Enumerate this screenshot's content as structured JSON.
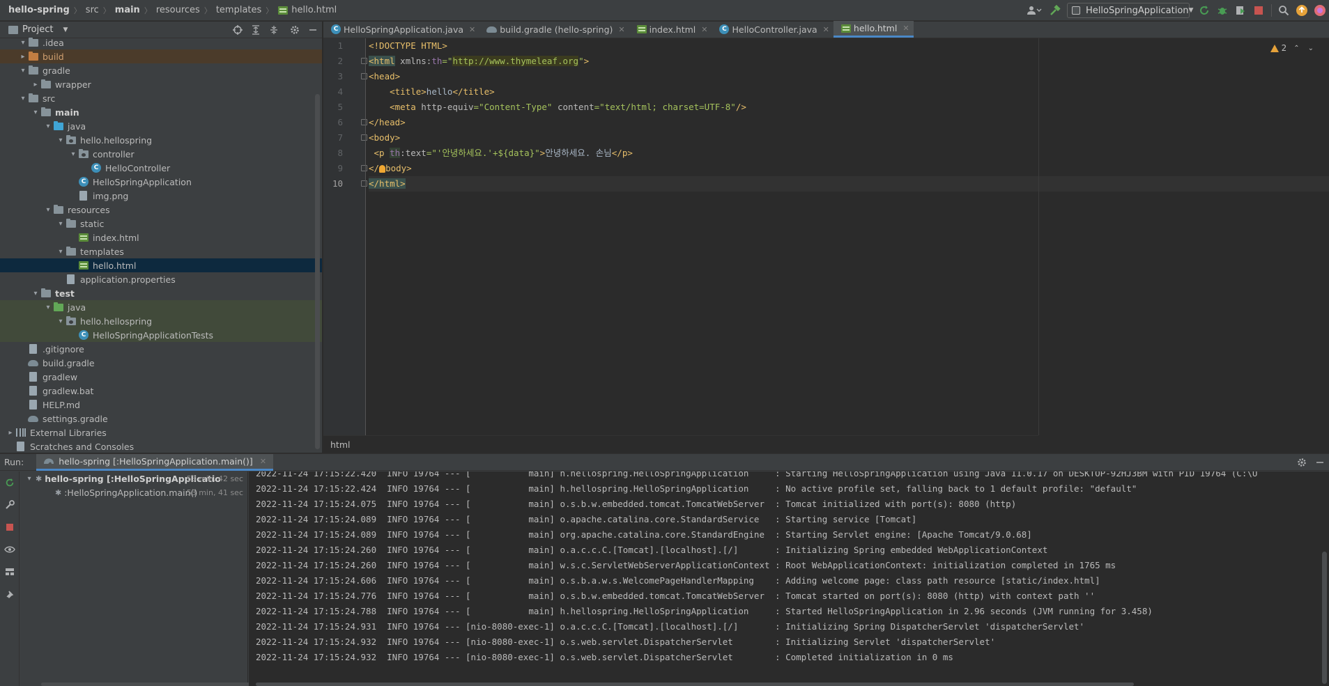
{
  "breadcrumb": [
    {
      "label": "hello-spring",
      "bold": true
    },
    {
      "label": "src",
      "bold": false
    },
    {
      "label": "main",
      "bold": true
    },
    {
      "label": "resources",
      "bold": false
    },
    {
      "label": "templates",
      "bold": false
    },
    {
      "label": "hello.html",
      "bold": false
    }
  ],
  "toolbar": {
    "run_config": "HelloSpringApplication"
  },
  "project": {
    "title": "Project",
    "tree": [
      {
        "label": ".idea",
        "level": 1,
        "arrow": "▾",
        "icon": "folder",
        "style": ""
      },
      {
        "label": "build",
        "level": 1,
        "arrow": "▸",
        "icon": "folder-orange",
        "style": "excluded"
      },
      {
        "label": "gradle",
        "level": 1,
        "arrow": "▾",
        "icon": "folder",
        "style": ""
      },
      {
        "label": "wrapper",
        "level": 2,
        "arrow": "▸",
        "icon": "folder",
        "style": ""
      },
      {
        "label": "src",
        "level": 1,
        "arrow": "▾",
        "icon": "folder",
        "style": ""
      },
      {
        "label": "main",
        "level": 2,
        "arrow": "▾",
        "icon": "folder",
        "style": "bold"
      },
      {
        "label": "java",
        "level": 3,
        "arrow": "▾",
        "icon": "folder-blue",
        "style": ""
      },
      {
        "label": "hello.hellospring",
        "level": 4,
        "arrow": "▾",
        "icon": "package",
        "style": ""
      },
      {
        "label": "controller",
        "level": 5,
        "arrow": "▾",
        "icon": "package",
        "style": ""
      },
      {
        "label": "HelloController",
        "level": 6,
        "arrow": "",
        "icon": "class",
        "style": ""
      },
      {
        "label": "HelloSpringApplication",
        "level": 5,
        "arrow": "",
        "icon": "class",
        "style": ""
      },
      {
        "label": "img.png",
        "level": 5,
        "arrow": "",
        "icon": "file",
        "style": ""
      },
      {
        "label": "resources",
        "level": 3,
        "arrow": "▾",
        "icon": "folder",
        "style": ""
      },
      {
        "label": "static",
        "level": 4,
        "arrow": "▾",
        "icon": "folder",
        "style": ""
      },
      {
        "label": "index.html",
        "level": 5,
        "arrow": "",
        "icon": "html",
        "style": ""
      },
      {
        "label": "templates",
        "level": 4,
        "arrow": "▾",
        "icon": "folder",
        "style": ""
      },
      {
        "label": "hello.html",
        "level": 5,
        "arrow": "",
        "icon": "html",
        "style": "sel"
      },
      {
        "label": "application.properties",
        "level": 4,
        "arrow": "",
        "icon": "file",
        "style": ""
      },
      {
        "label": "test",
        "level": 2,
        "arrow": "▾",
        "icon": "folder",
        "style": "bold"
      },
      {
        "label": "java",
        "level": 3,
        "arrow": "▾",
        "icon": "folder-green",
        "style": "test"
      },
      {
        "label": "hello.hellospring",
        "level": 4,
        "arrow": "▾",
        "icon": "package",
        "style": "test"
      },
      {
        "label": "HelloSpringApplicationTests",
        "level": 5,
        "arrow": "",
        "icon": "class",
        "style": "test"
      },
      {
        "label": ".gitignore",
        "level": 1,
        "arrow": "",
        "icon": "file",
        "style": ""
      },
      {
        "label": "build.gradle",
        "level": 1,
        "arrow": "",
        "icon": "gradle",
        "style": ""
      },
      {
        "label": "gradlew",
        "level": 1,
        "arrow": "",
        "icon": "file",
        "style": ""
      },
      {
        "label": "gradlew.bat",
        "level": 1,
        "arrow": "",
        "icon": "file",
        "style": ""
      },
      {
        "label": "HELP.md",
        "level": 1,
        "arrow": "",
        "icon": "file",
        "style": ""
      },
      {
        "label": "settings.gradle",
        "level": 1,
        "arrow": "",
        "icon": "gradle",
        "style": ""
      },
      {
        "label": "External Libraries",
        "level": 0,
        "arrow": "▸",
        "icon": "library",
        "style": ""
      },
      {
        "label": "Scratches and Consoles",
        "level": 0,
        "arrow": "",
        "icon": "file",
        "style": ""
      }
    ]
  },
  "tabs": [
    {
      "label": "HelloSpringApplication.java",
      "icon": "class",
      "active": false
    },
    {
      "label": "build.gradle (hello-spring)",
      "icon": "gradle",
      "active": false
    },
    {
      "label": "index.html",
      "icon": "html",
      "active": false
    },
    {
      "label": "HelloController.java",
      "icon": "class",
      "active": false
    },
    {
      "label": "hello.html",
      "icon": "html",
      "active": true
    }
  ],
  "editor": {
    "warning_count": "2",
    "line_numbers": [
      "1",
      "2",
      "3",
      "4",
      "5",
      "6",
      "7",
      "8",
      "9",
      "10"
    ],
    "current_line": 10,
    "status_path": "html",
    "code": [
      [
        {
          "t": "<!DOCTYPE HTML>",
          "c": "t-tag"
        }
      ],
      [
        {
          "t": "<html",
          "c": "t-tag hl-tag"
        },
        {
          "t": " xmlns:",
          "c": "t-attr"
        },
        {
          "t": "th",
          "c": "t-ns"
        },
        {
          "t": "=\"",
          "c": "t-str"
        },
        {
          "t": "http://www.thymeleaf.org",
          "c": "t-str hl-url"
        },
        {
          "t": "\"",
          "c": "t-str"
        },
        {
          "t": ">",
          "c": "t-tag"
        }
      ],
      [
        {
          "t": "<head>",
          "c": "t-tag"
        }
      ],
      [
        {
          "t": "    <title>",
          "c": "t-tag"
        },
        {
          "t": "hello",
          "c": "t-text"
        },
        {
          "t": "</title>",
          "c": "t-tag"
        }
      ],
      [
        {
          "t": "    <meta ",
          "c": "t-tag"
        },
        {
          "t": "http-equiv",
          "c": "t-attr"
        },
        {
          "t": "=\"Content-Type\" ",
          "c": "t-str"
        },
        {
          "t": "content",
          "c": "t-attr"
        },
        {
          "t": "=\"text/html; charset=UTF-8\"",
          "c": "t-str"
        },
        {
          "t": "/>",
          "c": "t-tag"
        }
      ],
      [
        {
          "t": "</head>",
          "c": "t-tag"
        }
      ],
      [
        {
          "t": "<body>",
          "c": "t-tag"
        }
      ],
      [
        {
          "t": " <p ",
          "c": "t-tag"
        },
        {
          "t": "th",
          "c": "t-ns hl-ns"
        },
        {
          "t": ":text",
          "c": "t-attr"
        },
        {
          "t": "=\"'안녕하세요.'+${data}\"",
          "c": "t-str"
        },
        {
          "t": ">",
          "c": "t-tag"
        },
        {
          "t": "안녕하세요. 손님",
          "c": "t-text"
        },
        {
          "t": "</p>",
          "c": "t-tag"
        }
      ],
      [
        {
          "t": "</",
          "c": "t-tag"
        },
        {
          "t": "BULB",
          "c": "bulb"
        },
        {
          "t": "body>",
          "c": "t-tag"
        }
      ],
      [
        {
          "t": "</html>",
          "c": "t-tag hl-tag"
        }
      ]
    ]
  },
  "run": {
    "label": "Run:",
    "tab_label": "hello-spring [:HelloSpringApplication.main()]",
    "tree": [
      {
        "label": "hello-spring [:HelloSpringApplicatio",
        "time": "53 min, 42 sec",
        "level": 0,
        "bold": true
      },
      {
        "label": ":HelloSpringApplication.main()",
        "time": "53 min, 41 sec",
        "level": 1,
        "bold": false
      }
    ],
    "log": [
      "2022-11-24 17:15:22.420  INFO 19764 --- [           main] h.hellospring.HelloSpringApplication     : Starting HelloSpringApplication using Java 11.0.17 on DESKTOP-92HJ3BM with PID 19764 (C:\\U",
      "2022-11-24 17:15:22.424  INFO 19764 --- [           main] h.hellospring.HelloSpringApplication     : No active profile set, falling back to 1 default profile: \"default\"",
      "2022-11-24 17:15:24.075  INFO 19764 --- [           main] o.s.b.w.embedded.tomcat.TomcatWebServer  : Tomcat initialized with port(s): 8080 (http)",
      "2022-11-24 17:15:24.089  INFO 19764 --- [           main] o.apache.catalina.core.StandardService   : Starting service [Tomcat]",
      "2022-11-24 17:15:24.089  INFO 19764 --- [           main] org.apache.catalina.core.StandardEngine  : Starting Servlet engine: [Apache Tomcat/9.0.68]",
      "2022-11-24 17:15:24.260  INFO 19764 --- [           main] o.a.c.c.C.[Tomcat].[localhost].[/]       : Initializing Spring embedded WebApplicationContext",
      "2022-11-24 17:15:24.260  INFO 19764 --- [           main] w.s.c.ServletWebServerApplicationContext : Root WebApplicationContext: initialization completed in 1765 ms",
      "2022-11-24 17:15:24.606  INFO 19764 --- [           main] o.s.b.a.w.s.WelcomePageHandlerMapping    : Adding welcome page: class path resource [static/index.html]",
      "2022-11-24 17:15:24.776  INFO 19764 --- [           main] o.s.b.w.embedded.tomcat.TomcatWebServer  : Tomcat started on port(s): 8080 (http) with context path ''",
      "2022-11-24 17:15:24.788  INFO 19764 --- [           main] h.hellospring.HelloSpringApplication     : Started HelloSpringApplication in 2.96 seconds (JVM running for 3.458)",
      "2022-11-24 17:15:24.931  INFO 19764 --- [nio-8080-exec-1] o.a.c.c.C.[Tomcat].[localhost].[/]       : Initializing Spring DispatcherServlet 'dispatcherServlet'",
      "2022-11-24 17:15:24.932  INFO 19764 --- [nio-8080-exec-1] o.s.web.servlet.DispatcherServlet        : Initializing Servlet 'dispatcherServlet'",
      "2022-11-24 17:15:24.932  INFO 19764 --- [nio-8080-exec-1] o.s.web.servlet.DispatcherServlet        : Completed initialization in 0 ms"
    ]
  },
  "colors": {
    "accent": "#4a88c7",
    "selection": "#0d293e",
    "stop": "#c75450",
    "run": "#499c54"
  }
}
